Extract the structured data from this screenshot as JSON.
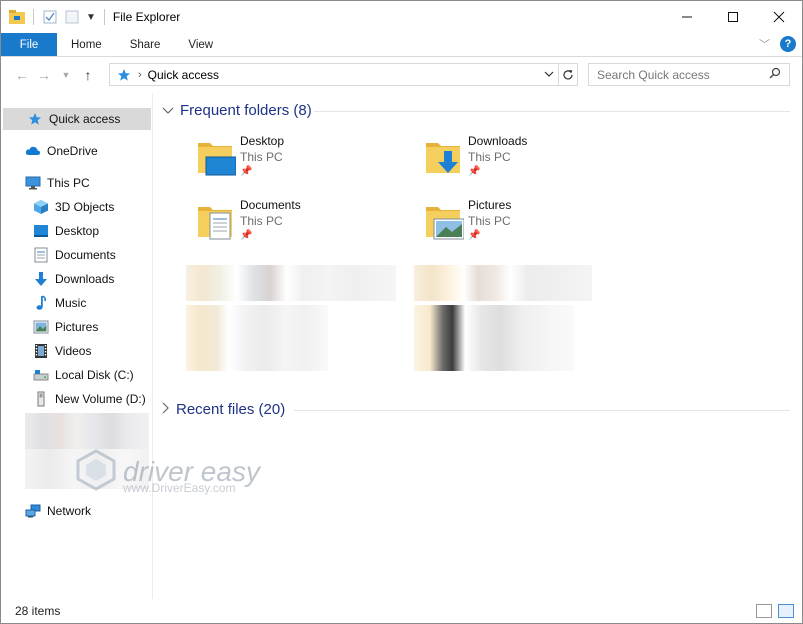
{
  "window": {
    "title": "File Explorer"
  },
  "ribbon": {
    "tabs": [
      "File",
      "Home",
      "Share",
      "View"
    ]
  },
  "address": {
    "path": "Quick access",
    "search_placeholder": "Search Quick access"
  },
  "nav": {
    "quick_access": "Quick access",
    "onedrive": "OneDrive",
    "this_pc": "This PC",
    "items": [
      "3D Objects",
      "Desktop",
      "Documents",
      "Downloads",
      "Music",
      "Pictures",
      "Videos",
      "Local Disk (C:)",
      "New Volume (D:)"
    ],
    "network": "Network"
  },
  "groups": {
    "frequent": "Frequent folders (8)",
    "recent": "Recent files (20)"
  },
  "folders": [
    {
      "name": "Desktop",
      "location": "This PC"
    },
    {
      "name": "Downloads",
      "location": "This PC"
    },
    {
      "name": "Documents",
      "location": "This PC"
    },
    {
      "name": "Pictures",
      "location": "This PC"
    }
  ],
  "status": {
    "item_count": "28 items"
  },
  "watermark": {
    "brand": "driver easy",
    "url": "www.DriverEasy.com"
  },
  "colors": {
    "accent": "#1979ca",
    "group_header": "#1e3287",
    "folder_yellow": "#f3c94f"
  },
  "icons": {
    "quick_access": "star-icon",
    "onedrive": "cloud-icon",
    "this_pc": "monitor-icon",
    "network": "network-icon"
  }
}
